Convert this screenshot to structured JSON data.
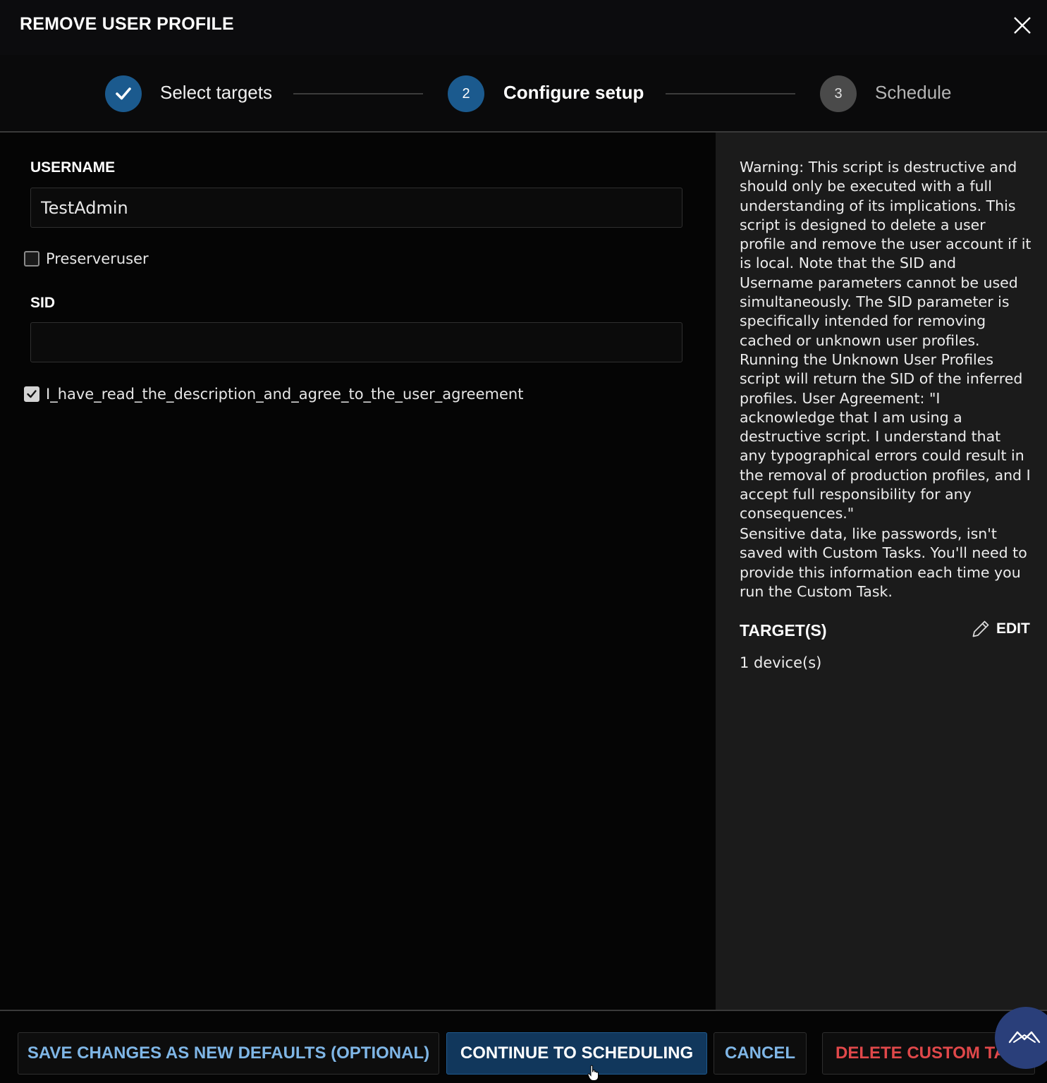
{
  "dialog": {
    "title": "REMOVE USER PROFILE"
  },
  "stepper": {
    "steps": [
      {
        "number": "",
        "label": "Select targets",
        "state": "complete"
      },
      {
        "number": "2",
        "label": "Configure setup",
        "state": "active"
      },
      {
        "number": "3",
        "label": "Schedule",
        "state": "pending"
      }
    ]
  },
  "form": {
    "username": {
      "label": "USERNAME",
      "value": "TestAdmin"
    },
    "preserve_user": {
      "label": "Preserveruser",
      "checked": false
    },
    "sid": {
      "label": "SID",
      "value": ""
    },
    "agreement": {
      "label": "I_have_read_the_description_and_agree_to_the_user_agreement",
      "checked": true
    }
  },
  "side_panel": {
    "description": "Warning: This script is destructive and should only be executed with a full understanding of its implications. This script is designed to delete a user profile and remove the user account if it is local. Note that the SID and Username parameters cannot be used simultaneously. The SID parameter is specifically intended for removing cached or unknown user profiles. Running the Unknown User Profiles script will return the SID of the inferred profiles. User Agreement: \"I acknowledge that I am using a destructive script. I understand that any typographical errors could result in the removal of production profiles, and I accept full responsibility for any consequences.\"",
    "sensitive_note": "Sensitive data, like passwords, isn't saved with Custom Tasks. You'll need to provide this information each time you run the Custom Task.",
    "targets_label": "TARGET(S)",
    "edit_label": "EDIT",
    "device_count": "1 device(s)"
  },
  "footer": {
    "save_defaults_label": "SAVE CHANGES AS NEW DEFAULTS (OPTIONAL)",
    "continue_label": "CONTINUE TO SCHEDULING",
    "cancel_label": "CANCEL",
    "delete_label": "DELETE CUSTOM TASK"
  },
  "colors": {
    "accent": "#1b5a8e",
    "primary_button": "#11375c",
    "link_text": "#7fb6e6",
    "danger_text": "#e0484a",
    "panel_bg": "#1b1b1b"
  }
}
